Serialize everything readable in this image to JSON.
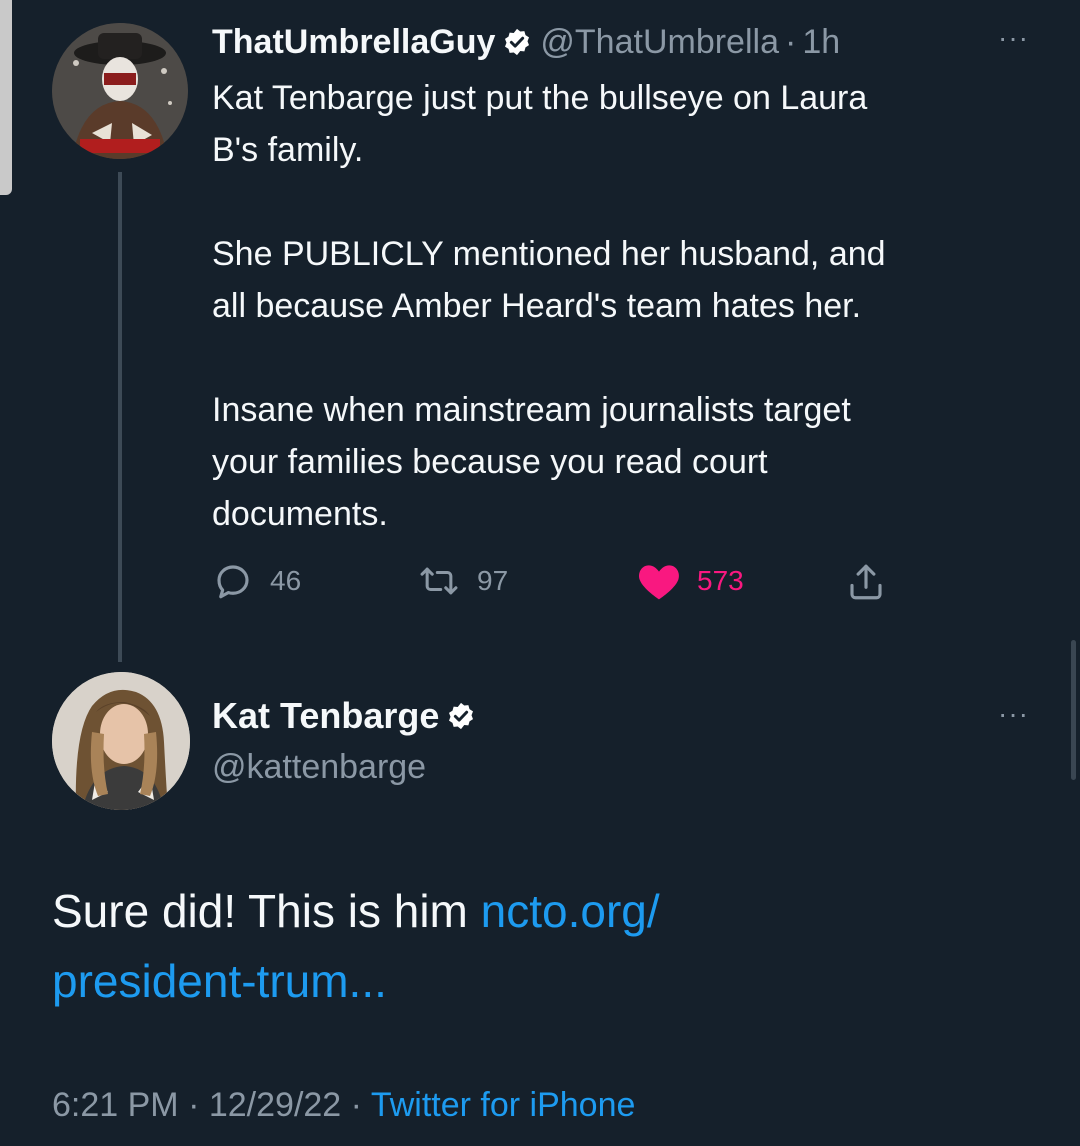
{
  "tweet": {
    "display_name": "ThatUmbrellaGuy",
    "handle": "@ThatUmbrella",
    "separator": "·",
    "time": "1h",
    "more": "···",
    "text": {
      "p1_line1": "Kat Tenbarge just put the bullseye on Laura",
      "p1_line2": "B's family.",
      "p2_line1": "She PUBLICLY mentioned her husband, and",
      "p2_line2": "all because Amber Heard's team hates her.",
      "p3_line1": "Insane when mainstream journalists target",
      "p3_line2": "your families because you read court",
      "p3_line3": "documents."
    },
    "actions": {
      "reply_count": "46",
      "retweet_count": "97",
      "like_count": "573"
    },
    "like_color": "#f91880",
    "verified_icon": "verified-badge-icon"
  },
  "reply": {
    "display_name": "Kat Tenbarge",
    "handle": "@kattenbarge",
    "more": "···",
    "text_before_link": "Sure did! This is him ",
    "link_line1": "ncto.org/",
    "link_line2": "president-trum...",
    "link_color": "#1d9bf0",
    "meta_time": "6:21 PM",
    "meta_separator": "·",
    "meta_date": "12/29/22",
    "meta_source": "Twitter for iPhone"
  },
  "colors": {
    "background": "#15202b",
    "secondary_text": "#8b98a5",
    "accent": "#1d9bf0"
  }
}
